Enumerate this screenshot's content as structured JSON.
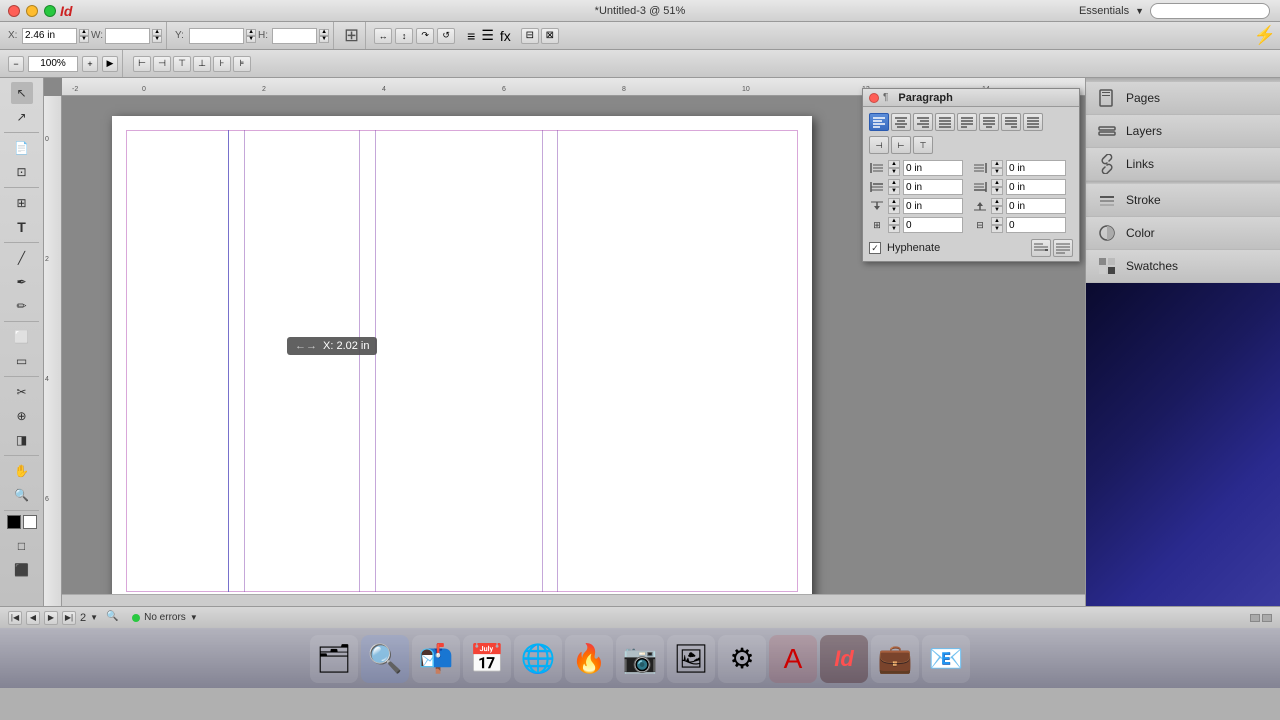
{
  "titlebar": {
    "title": "*Untitled-3 @ 51%",
    "essentials": "Essentials"
  },
  "toolbar1": {
    "x_label": "X:",
    "x_value": "2.46 in",
    "y_label": "Y:",
    "y_value": "",
    "w_label": "W:",
    "w_value": "",
    "h_label": "H:",
    "h_value": "",
    "zoom_value": "51.5%"
  },
  "toolbar2": {
    "zoom_pct": "100%"
  },
  "tooltip": {
    "text": "X: 2.02 in"
  },
  "right_panel": {
    "items": [
      {
        "label": "Pages",
        "icon": "📄"
      },
      {
        "label": "Layers",
        "icon": "🗂"
      },
      {
        "label": "Links",
        "icon": "🔗"
      },
      {
        "label": "Stroke",
        "icon": "✏"
      },
      {
        "label": "Color",
        "icon": "🎨"
      },
      {
        "label": "Swatches",
        "icon": "⬛"
      }
    ]
  },
  "paragraph": {
    "title": "Paragraph",
    "indent_fields": [
      {
        "label": "left indent",
        "value": "0 in"
      },
      {
        "label": "right indent",
        "value": "0 in"
      },
      {
        "label": "first indent",
        "value": "0 in"
      },
      {
        "label": "last indent",
        "value": "0 in"
      },
      {
        "label": "space before",
        "value": "0 in"
      },
      {
        "label": "space after",
        "value": "0 in"
      },
      {
        "label": "grid align",
        "value": "0"
      },
      {
        "label": "grid align2",
        "value": "0"
      }
    ],
    "hyphenate_label": "Hyphenate",
    "hyphenate_checked": true
  },
  "statusbar": {
    "page": "2",
    "status": "No errors"
  },
  "dock": {
    "icons": [
      "🗂",
      "🔍",
      "🖼",
      "📅",
      "🌐",
      "🔥",
      "📷",
      "🖼",
      "⚙",
      "📄",
      "🎭",
      "🖥",
      "💼",
      "📧"
    ]
  }
}
